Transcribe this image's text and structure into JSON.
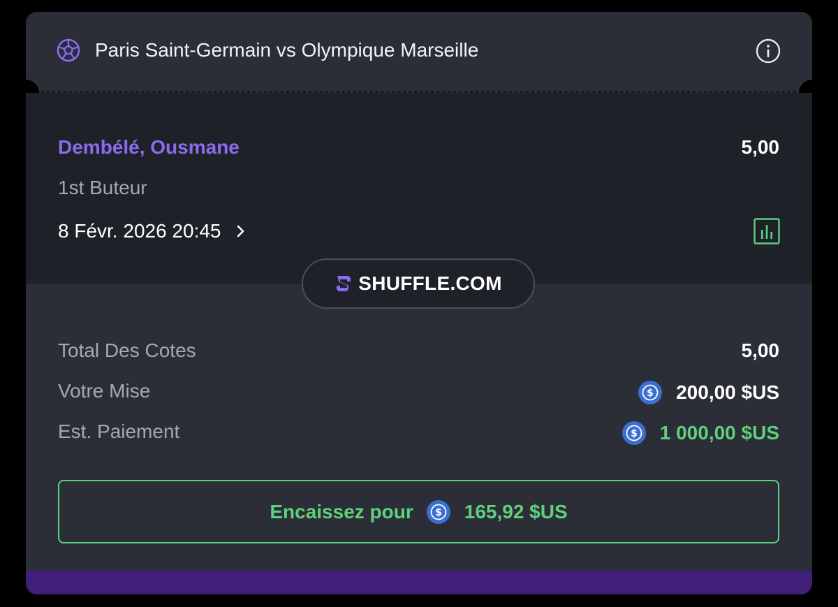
{
  "header": {
    "match_title": "Paris Saint-Germain vs Olympique Marseille",
    "sport_icon": "soccer-ball-icon",
    "info_icon": "info-icon"
  },
  "selection": {
    "player": "Dembélé, Ousmane",
    "odds": "5,00",
    "market": "1st Buteur",
    "datetime": "8 Févr. 2026 20:45",
    "chevron_icon": "chevron-right-icon",
    "stats_icon": "bar-chart-icon"
  },
  "brand": {
    "name": "SHUFFLE.COM",
    "logo_icon": "shuffle-logo-icon"
  },
  "summary": {
    "total_odds_label": "Total Des Cotes",
    "total_odds_value": "5,00",
    "stake_label": "Votre Mise",
    "stake_value": "200,00 $US",
    "payout_label": "Est. Paiement",
    "payout_value": "1 000,00 $US",
    "coin_icon": "usdc-coin-icon"
  },
  "cashout": {
    "label": "Encaissez pour",
    "amount": "165,92 $US"
  },
  "colors": {
    "accent_purple": "#8a6cf0",
    "success_green": "#5fd07b",
    "card_bg": "#2b2e37",
    "section_bg": "#1f2128",
    "footer_purple": "#3f1f7a",
    "coin_blue": "#3a6fd0"
  }
}
